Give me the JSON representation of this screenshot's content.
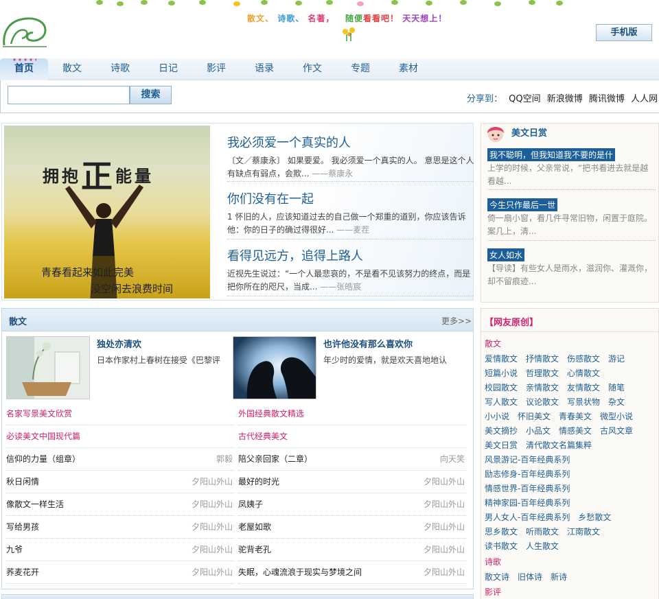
{
  "header": {
    "slogan": [
      "散文、",
      "诗歌、",
      "名著，",
      "随便",
      "看看吧！",
      "天天想上！"
    ],
    "mobile_button": "手机版"
  },
  "nav": {
    "items": [
      "首页",
      "散文",
      "诗歌",
      "日记",
      "影评",
      "语录",
      "作文",
      "专题",
      "素材"
    ]
  },
  "search": {
    "button": "搜索",
    "placeholder": ""
  },
  "share": {
    "label": "分享到：",
    "links": [
      "QQ空间",
      "新浪微博",
      "腾讯微博",
      "人人网"
    ]
  },
  "feature": {
    "image_title_pre": "拥抱",
    "image_title_big": "正",
    "image_title_post": "能量",
    "image_caption1": "青春看起来如此完美",
    "image_caption2": "没空闲去浪费时间",
    "articles": [
      {
        "title": "我必须爱一个真实的人",
        "summary": "〔文／蔡康永〕 如果要爱。 我必须爱一个真实的人。 意思是这个人有缺点有弱点，会欺...",
        "author": "——蔡康永"
      },
      {
        "title": "你们没有在一起",
        "summary": "1 怀旧的人，应该知道过去的自己做一个郑重的道别，你应该告诉他：你的日子的确过得很好...",
        "author": "——麦茬"
      },
      {
        "title": "看得见远方，追得上路人",
        "summary": "近视先生说过：“一个人最悲哀的，不是看不见该努力的终点，而是把你所在的咫尺，当成...",
        "author": "——张皓宸"
      }
    ]
  },
  "daily": {
    "title": "美文日赏",
    "entries": [
      {
        "tag": "我不聪明，但我知道我不要的是什",
        "text": "上学的时候，父亲常说，“把书看进去就是越看越..."
      },
      {
        "tag": "今生只作最后一世",
        "text": "倚一扇小窗，看几件寻常旧物，闲置于庭院。案几上，清..."
      },
      {
        "tag": "女人如水",
        "text": "【导读】有些女人是雨水，滋润你、灌溉你，却不留痕迹..."
      }
    ]
  },
  "prose": {
    "title": "散文",
    "more": "更多>>",
    "cards": [
      {
        "title": "独处亦清欢",
        "summary": "日本作家村上春树在接受《巴黎评"
      },
      {
        "title": "也许他没有那么喜欢你",
        "summary": "年少时的爱情，就是欢天喜地地认"
      }
    ],
    "left_rows": [
      {
        "title": "名家写景美文欣赏",
        "author": ""
      },
      {
        "title": "必读美文中国现代篇",
        "author": ""
      },
      {
        "title": "信仰的力量（组章）",
        "author": "郭毅"
      },
      {
        "title": "秋日闲情",
        "author": "夕阳山外山"
      },
      {
        "title": "像散文一样生活",
        "author": "夕阳山外山"
      },
      {
        "title": "写给男孩",
        "author": "夕阳山外山"
      },
      {
        "title": "九爷",
        "author": "夕阳山外山"
      },
      {
        "title": "荞麦花开",
        "author": "夕阳山外山"
      }
    ],
    "right_rows": [
      {
        "title": "外国经典散文精选",
        "author": ""
      },
      {
        "title": "古代经典美文",
        "author": ""
      },
      {
        "title": "陪父亲回家（二章）",
        "author": "向天笑"
      },
      {
        "title": "最好的时光",
        "author": "夕阳山外山"
      },
      {
        "title": "凤姨子",
        "author": "夕阳山外山"
      },
      {
        "title": "老屋如歌",
        "author": "夕阳山外山"
      },
      {
        "title": "驼背老孔",
        "author": "夕阳山外山"
      },
      {
        "title": "失眠，心魂流浪于现实与梦境之间",
        "author": "夕阳山外山"
      }
    ]
  },
  "original": {
    "title": "【网友原创】",
    "cat_prose": "散文",
    "prose_rows": [
      [
        "爱情散文",
        "抒情散文",
        "伤感散文",
        "游记"
      ],
      [
        "短篇小说",
        "哲理散文",
        "心情散文"
      ],
      [
        "校园散文",
        "亲情散文",
        "友情散文",
        "随笔"
      ],
      [
        "写人散文",
        "议论散文",
        "写景状物",
        "杂文"
      ],
      [
        "小小说",
        "怀旧美文",
        "青春美文",
        "微型小说"
      ],
      [
        "美文摘抄",
        "小品文",
        "情感美文",
        "古风文章"
      ],
      [
        "美文日赏",
        "清代散文名篇集粹"
      ],
      [
        "风景游记-百年经典系列"
      ],
      [
        "励志修身-百年经典系列"
      ],
      [
        "情感世界-百年经典系列"
      ],
      [
        "精神家园-百年经典系列"
      ],
      [
        "男人女人-百年经典系列",
        "乡愁散文"
      ],
      [
        "思乡散文",
        "听雨散文",
        "江南散文"
      ],
      [
        "读书散文",
        "人生散文"
      ]
    ],
    "cat_poem": "诗歌",
    "poem_row": [
      "散文诗",
      "旧体诗",
      "新诗"
    ],
    "cat_film": "影评"
  }
}
